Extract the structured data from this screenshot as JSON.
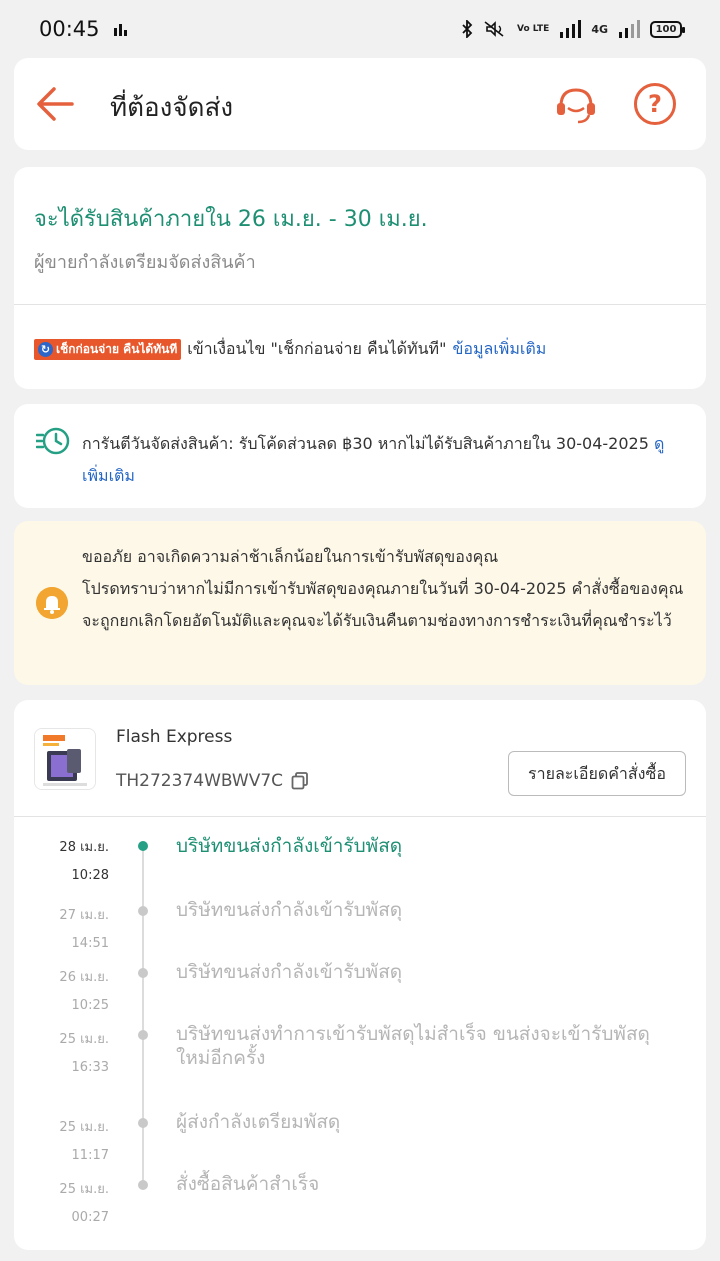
{
  "status_bar": {
    "time": "00:45",
    "battery": "100",
    "network": "4G",
    "volte": "Vo LTE"
  },
  "header": {
    "title": "ที่ต้องจัดส่ง"
  },
  "delivery": {
    "eta": "จะได้รับสินค้าภายใน 26 เม.ย. - 30 เม.ย.",
    "status": "ผู้ขายกำลังเตรียมจัดส่งสินค้า",
    "promo_badge": "เช็กก่อนจ่าย คืนได้ทันที",
    "promo_text": "เข้าเงื่อนไข \"เช็กก่อนจ่าย คืนได้ทันที\"",
    "promo_link": "ข้อมูลเพิ่มเติม"
  },
  "guarantee": {
    "text": "การันตีวันจัดส่งสินค้า: รับโค้ดส่วนลด ฿30 หากไม่ได้รับสินค้าภายใน 30-04-2025",
    "link": "ดูเพิ่มเติม"
  },
  "notice": {
    "line1": "ขออภัย อาจเกิดความล่าช้าเล็กน้อยในการเข้ารับพัสดุของคุณ",
    "line2": "โปรดทราบว่าหากไม่มีการเข้ารับพัสดุของคุณภายในวันที่ 30-04-2025 คำสั่งซื้อของคุณจะถูกยกเลิกโดยอัตโนมัติและคุณจะได้รับเงินคืนตามช่องทางการชำระเงินที่คุณชำระไว้"
  },
  "shipment": {
    "carrier": "Flash Express",
    "tracking_no": "TH272374WBWV7C",
    "order_detail_button": "รายละเอียดคำสั่งซื้อ"
  },
  "timeline": [
    {
      "date": "28 เม.ย.",
      "time": "10:28",
      "text": "บริษัทขนส่งกำลังเข้ารับพัสดุ",
      "active": true
    },
    {
      "date": "27 เม.ย.",
      "time": "14:51",
      "text": "บริษัทขนส่งกำลังเข้ารับพัสดุ",
      "active": false
    },
    {
      "date": "26 เม.ย.",
      "time": "10:25",
      "text": "บริษัทขนส่งกำลังเข้ารับพัสดุ",
      "active": false
    },
    {
      "date": "25 เม.ย.",
      "time": "16:33",
      "text": "บริษัทขนส่งทำการเข้ารับพัสดุไม่สำเร็จ ขนส่งจะเข้ารับพัสดุใหม่อีกครั้ง",
      "active": false
    },
    {
      "date": "25 เม.ย.",
      "time": "11:17",
      "text": " ผู้ส่งกำลังเตรียมพัสดุ",
      "active": false
    },
    {
      "date": "25 เม.ย.",
      "time": "00:27",
      "text": "สั่งซื้อสินค้าสำเร็จ",
      "active": false
    }
  ],
  "colors": {
    "accent": "#e5603d",
    "success": "#1e8f73",
    "link": "#2466c4",
    "notice_bg": "#fdf8e8"
  },
  "icons": [
    "back-arrow-icon",
    "headset-icon",
    "help-icon",
    "clock-icon",
    "bell-icon",
    "copy-icon"
  ]
}
